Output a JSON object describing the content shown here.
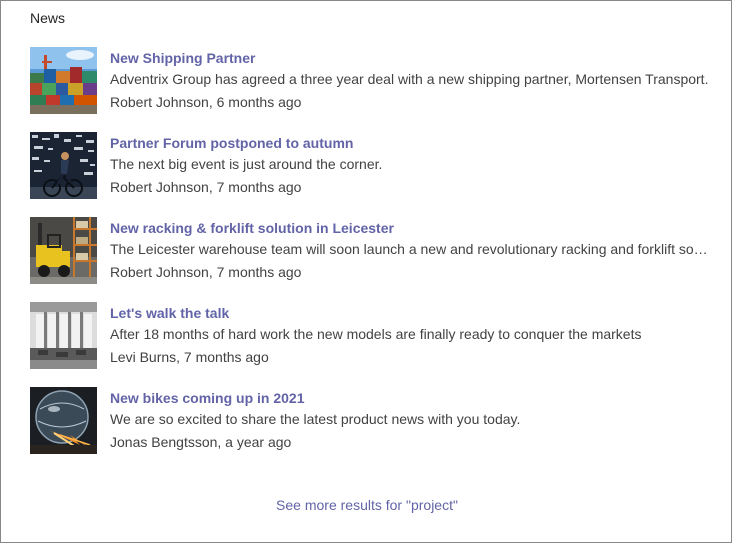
{
  "section": {
    "title": "News"
  },
  "news": [
    {
      "headline": "New Shipping Partner",
      "summary": "Adventrix Group has agreed a three year deal with a new shipping partner, Mortensen Transport.",
      "byline": "Robert Johnson, 6 months ago",
      "thumb_icon": "shipping-containers-photo"
    },
    {
      "headline": "Partner Forum postponed to autumn",
      "summary": "The next big event is just around the corner.",
      "byline": "Robert Johnson, 7 months ago",
      "thumb_icon": "cyclist-photo"
    },
    {
      "headline": "New racking & forklift solution in Leicester",
      "summary": "The Leicester warehouse team will soon launch a new and revolutionary racking and forklift solution.",
      "byline": "Robert Johnson, 7 months ago",
      "thumb_icon": "forklift-photo"
    },
    {
      "headline": "Let's walk the talk",
      "summary": "After 18 months of hard work the new models are finally ready to conquer the markets",
      "byline": "Levi Burns, 7 months ago",
      "thumb_icon": "office-lobby-photo"
    },
    {
      "headline": "New bikes coming up in 2021",
      "summary": "We are so excited to share the latest product news with you today.",
      "byline": "Jonas Bengtsson, a year ago",
      "thumb_icon": "sparkler-sphere-photo"
    }
  ],
  "footer": {
    "see_more": "See more results for \"project\""
  },
  "colors": {
    "accent": "#6264a7",
    "text": "#424242",
    "border": "#8a8886"
  }
}
